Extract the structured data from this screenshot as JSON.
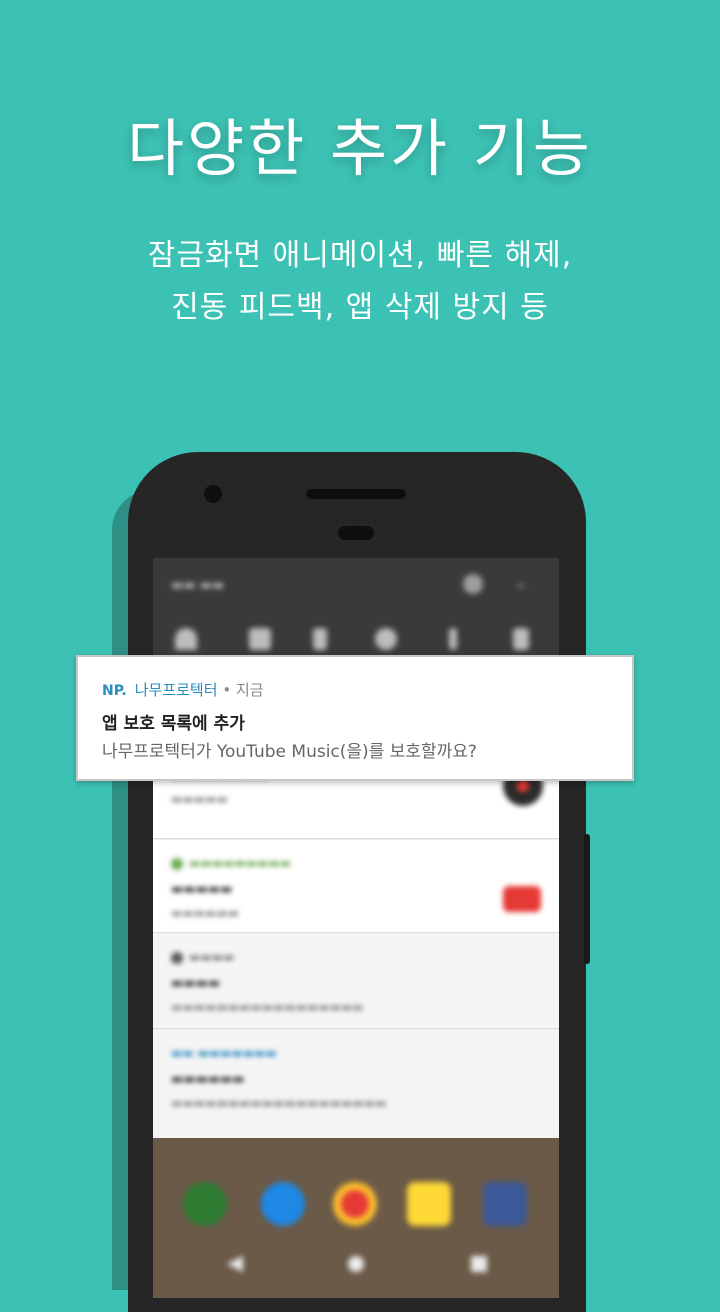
{
  "headline": "다양한 추가 기능",
  "subtitle": {
    "line1": "잠금화면 애니메이션, 빠른 해제,",
    "line2": "진동 피드백, 앱 삭제 방지 등"
  },
  "notification_popup": {
    "logo": "NP.",
    "app_name": "나무프로텍터",
    "separator": "•",
    "time": "지금",
    "title": "앱 보호 목록에 추가",
    "text": "나무프로텍터가 YouTube Music(을)를 보호할까요?"
  },
  "colors": {
    "background": "#3cc2b4",
    "phone_body": "#262626",
    "popup_accent": "#2b8cbf"
  }
}
